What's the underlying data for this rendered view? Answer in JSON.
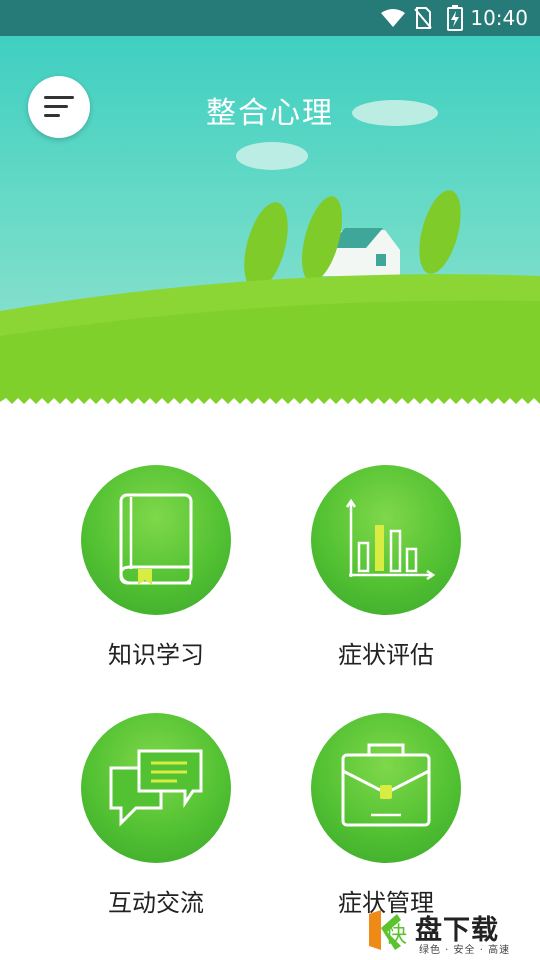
{
  "status_bar": {
    "time": "10:40",
    "background": "#267a78",
    "icons": [
      "wifi-icon",
      "no-sim-icon",
      "battery-icon"
    ]
  },
  "header": {
    "title": "整合心理",
    "menu_icon": "hamburger-menu-icon"
  },
  "colors": {
    "sky": "#3fcfc1",
    "grass": "#8bd634",
    "tile_green": "#52c132",
    "label_text": "#222222"
  },
  "tiles": [
    {
      "label": "知识学习",
      "icon": "book-icon"
    },
    {
      "label": "症状评估",
      "icon": "bar-chart-icon"
    },
    {
      "label": "互动交流",
      "icon": "chat-bubbles-icon"
    },
    {
      "label": "症状管理",
      "icon": "briefcase-icon"
    }
  ],
  "watermark": {
    "logo_char": "快",
    "main": "盘下载",
    "sub": "绿色 · 安全 · 高速"
  }
}
